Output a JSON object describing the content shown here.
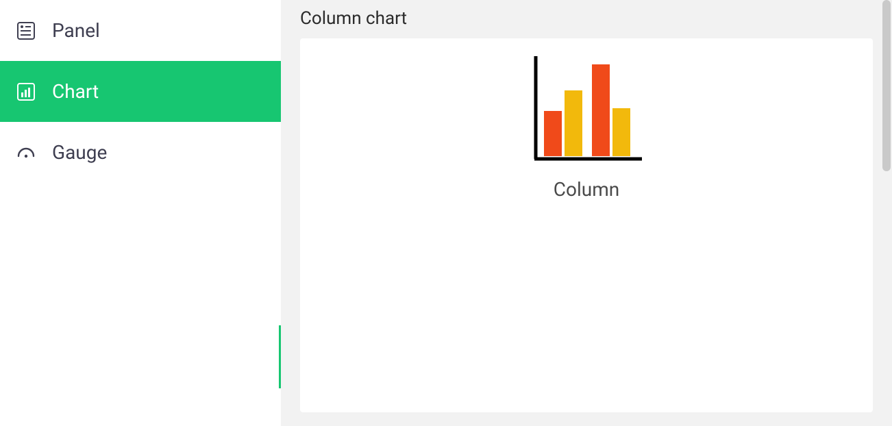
{
  "sidebar": {
    "items": [
      {
        "label": "Panel",
        "icon": "panel-icon",
        "active": false
      },
      {
        "label": "Chart",
        "icon": "chart-icon",
        "active": true
      },
      {
        "label": "Gauge",
        "icon": "gauge-icon",
        "active": false
      }
    ]
  },
  "main": {
    "title": "Column chart",
    "options": [
      {
        "label": "Column",
        "icon": "column-chart-icon"
      }
    ]
  },
  "colors": {
    "accent": "#17c671",
    "bar_red": "#f04a1a",
    "bar_yellow": "#f2b90c"
  }
}
